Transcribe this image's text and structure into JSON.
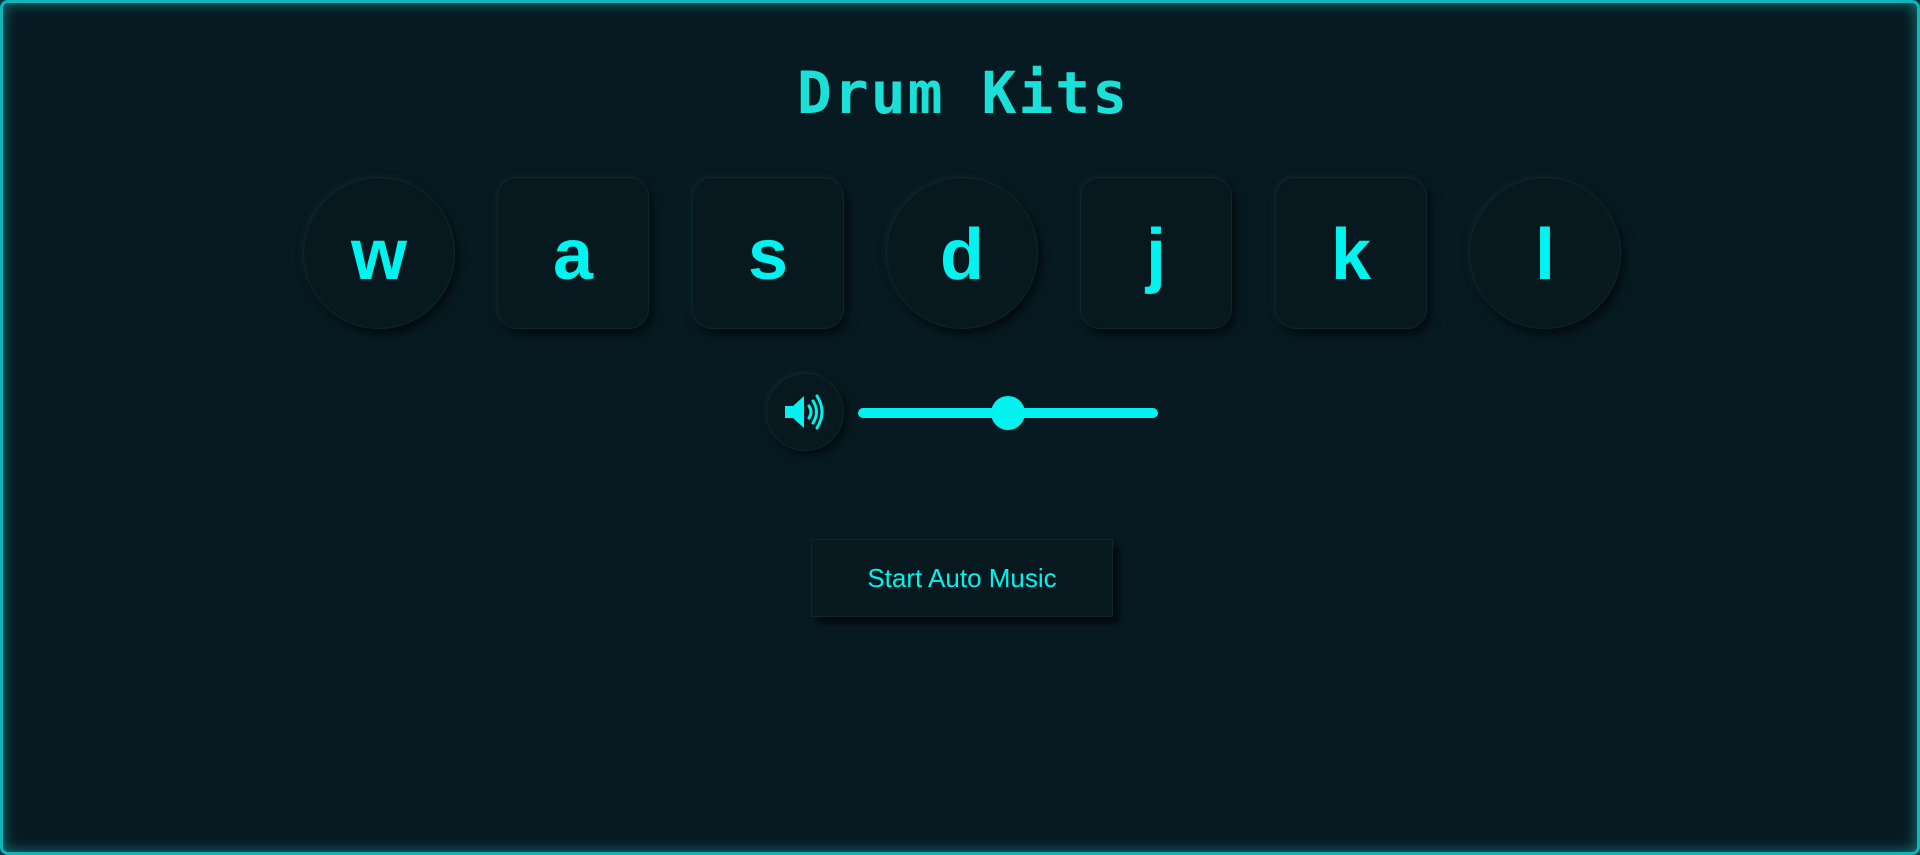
{
  "app": {
    "title": "Drum Kits"
  },
  "pads": [
    {
      "key": "w",
      "shape": "circle"
    },
    {
      "key": "a",
      "shape": "square"
    },
    {
      "key": "s",
      "shape": "square"
    },
    {
      "key": "d",
      "shape": "circle"
    },
    {
      "key": "j",
      "shape": "square"
    },
    {
      "key": "k",
      "shape": "square"
    },
    {
      "key": "l",
      "shape": "circle"
    }
  ],
  "volume": {
    "icon": "speaker-volume-icon",
    "level": 0.5
  },
  "auto_music": {
    "label": "Start Auto Music"
  },
  "colors": {
    "accent": "#00f3ee",
    "background": "#071a22",
    "border_glow": "#12b5b5"
  }
}
